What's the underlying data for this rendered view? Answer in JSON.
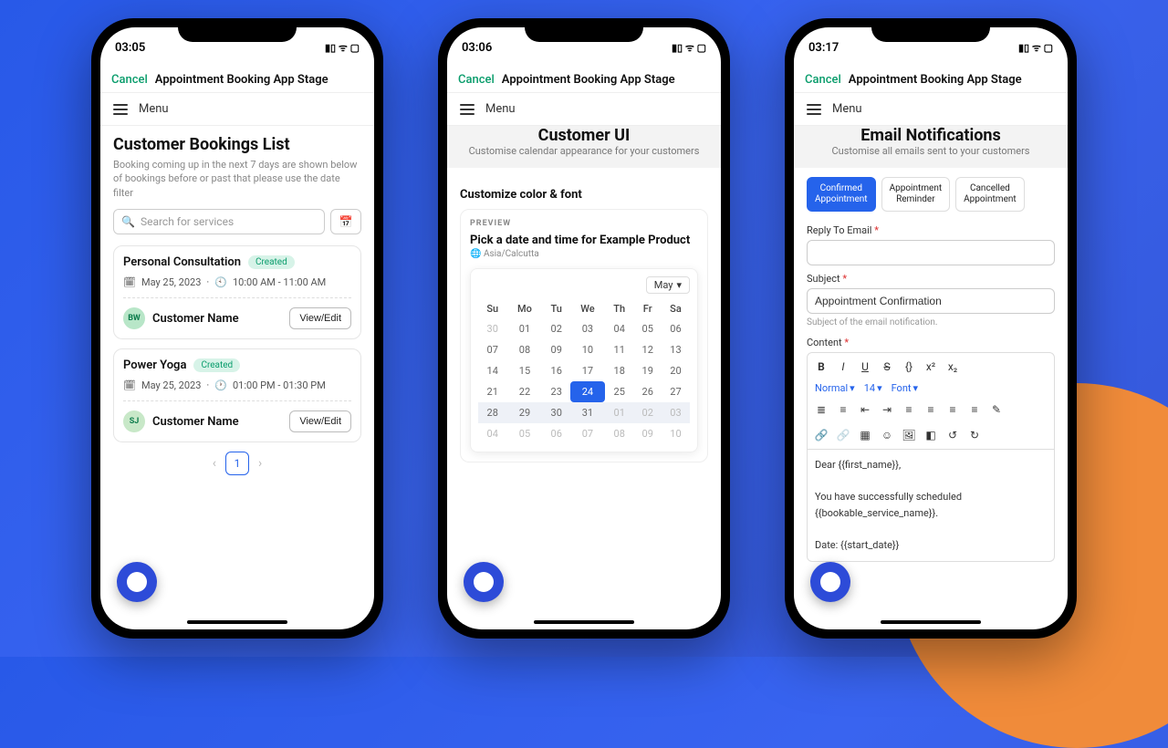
{
  "common": {
    "cancel": "Cancel",
    "app_title": "Appointment Booking App Stage",
    "menu": "Menu"
  },
  "phone1": {
    "time": "03:05",
    "heading": "Customer Bookings List",
    "subtext": "Booking coming up in the next 7 days are shown below of bookings before or past that please use the date filter",
    "search_placeholder": "Search for services",
    "bookings": [
      {
        "title": "Personal Consultation",
        "badge": "Created",
        "date": "May 25, 2023",
        "time": "10:00 AM - 11:00 AM",
        "avatar": "BW",
        "customer": "Customer Name",
        "action": "View/Edit"
      },
      {
        "title": "Power Yoga",
        "badge": "Created",
        "date": "May 25, 2023",
        "time": "01:00 PM - 01:30 PM",
        "avatar": "SJ",
        "customer": "Customer Name",
        "action": "View/Edit"
      }
    ],
    "page": "1"
  },
  "phone2": {
    "time": "03:06",
    "heading": "Customer UI",
    "subtext": "Customise calendar appearance for your customers",
    "section": "Customize color & font",
    "preview_label": "PREVIEW",
    "preview_title": "Pick a date and time for Example Product",
    "timezone": "Asia/Calcutta",
    "month": "May",
    "weekdays": [
      "Su",
      "Mo",
      "Tu",
      "We",
      "Th",
      "Fr",
      "Sa"
    ],
    "weeks": [
      [
        "30",
        "01",
        "02",
        "03",
        "04",
        "05",
        "06"
      ],
      [
        "07",
        "08",
        "09",
        "10",
        "11",
        "12",
        "13"
      ],
      [
        "14",
        "15",
        "16",
        "17",
        "18",
        "19",
        "20"
      ],
      [
        "21",
        "22",
        "23",
        "24",
        "25",
        "26",
        "27"
      ],
      [
        "28",
        "29",
        "30",
        "31",
        "01",
        "02",
        "03"
      ],
      [
        "04",
        "05",
        "06",
        "07",
        "08",
        "09",
        "10"
      ]
    ],
    "selected_day": "24"
  },
  "phone3": {
    "time": "03:17",
    "heading": "Email Notifications",
    "subtext": "Customise all emails sent to your customers",
    "tabs": [
      "Confirmed Appointment",
      "Appointment Reminder",
      "Cancelled Appointment"
    ],
    "active_tab": 0,
    "reply_label": "Reply To Email",
    "subject_label": "Subject",
    "subject_value": "Appointment Confirmation",
    "subject_hint": "Subject of the email notification.",
    "content_label": "Content",
    "format_style": "Normal",
    "format_size": "14",
    "format_font": "Font",
    "body_lines": [
      "Dear {{first_name}},",
      "",
      "You have successfully scheduled {{bookable_service_name}}.",
      "",
      "Date: {{start_date}}"
    ]
  }
}
